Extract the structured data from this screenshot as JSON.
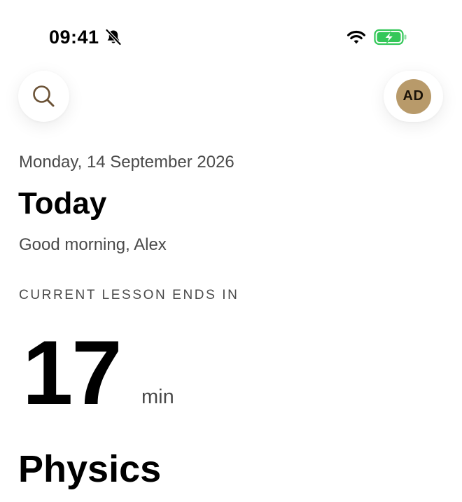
{
  "status_bar": {
    "time": "09:41",
    "icons": [
      "bell-slash-icon",
      "wifi-icon",
      "battery-charging-icon"
    ],
    "battery_color": "#34c759"
  },
  "header": {
    "search_icon": "search-icon",
    "profile": {
      "initials": "AD",
      "avatar_color": "#b89a6a"
    }
  },
  "main": {
    "date": "Monday, 14 September 2026",
    "title": "Today",
    "greeting": "Good morning, Alex",
    "countdown": {
      "label": "CURRENT LESSON ENDS IN",
      "value": "17",
      "unit": "min"
    },
    "lesson": {
      "subject": "Physics"
    }
  },
  "colors": {
    "accent": "#7a5a34",
    "secondary_text": "#4a4a4a"
  }
}
